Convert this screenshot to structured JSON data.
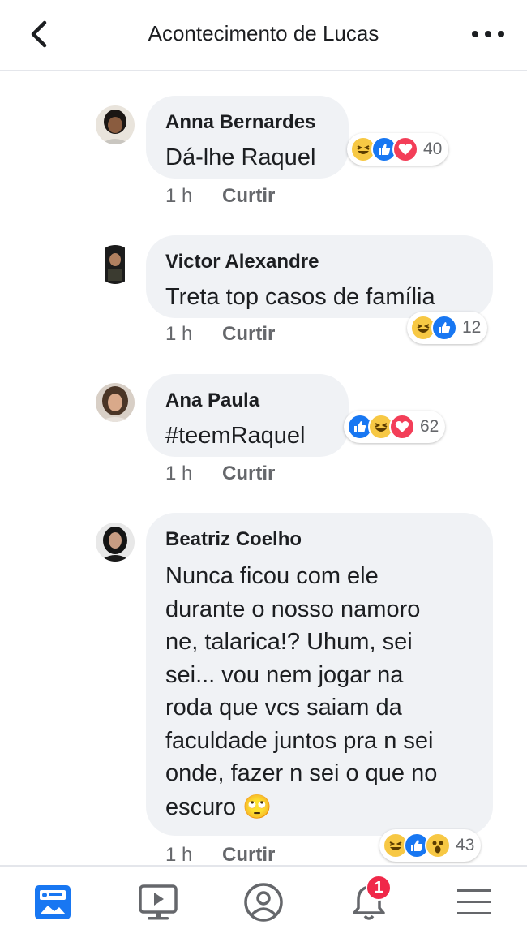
{
  "header": {
    "title": "Acontecimento de Lucas"
  },
  "comments": [
    {
      "author": "Anna Bernardes",
      "text": "Dá-lhe Raquel",
      "time": "1 h",
      "like_label": "Curtir",
      "reactions": [
        "haha",
        "like",
        "love"
      ],
      "reaction_count": "40"
    },
    {
      "author": "Victor Alexandre",
      "text": "Treta top casos de família",
      "time": "1 h",
      "like_label": "Curtir",
      "reactions": [
        "haha",
        "like"
      ],
      "reaction_count": "12"
    },
    {
      "author": "Ana Paula",
      "text": "#teemRaquel",
      "time": "1 h",
      "like_label": "Curtir",
      "reactions": [
        "like",
        "haha",
        "love"
      ],
      "reaction_count": "62"
    },
    {
      "author": "Beatriz Coelho",
      "text": "Nunca ficou com ele\ndurante o nosso namoro\nne, talarica!? Uhum, sei\nsei... vou nem jogar na\nroda que vcs saiam da\nfaculdade juntos pra n sei\nonde, fazer n sei o que no\nescuro",
      "emoji": "🙄",
      "time": "1 h",
      "like_label": "Curtir",
      "reactions": [
        "haha",
        "like",
        "wow"
      ],
      "reaction_count": "43"
    }
  ],
  "bottom_nav": {
    "items": [
      "news-feed",
      "watch",
      "profile",
      "notifications",
      "menu"
    ],
    "notification_badge": "1"
  },
  "colors": {
    "like": "#1877f2",
    "love": "#f33e58",
    "haha": "#f7c844",
    "badge": "#f02849"
  }
}
